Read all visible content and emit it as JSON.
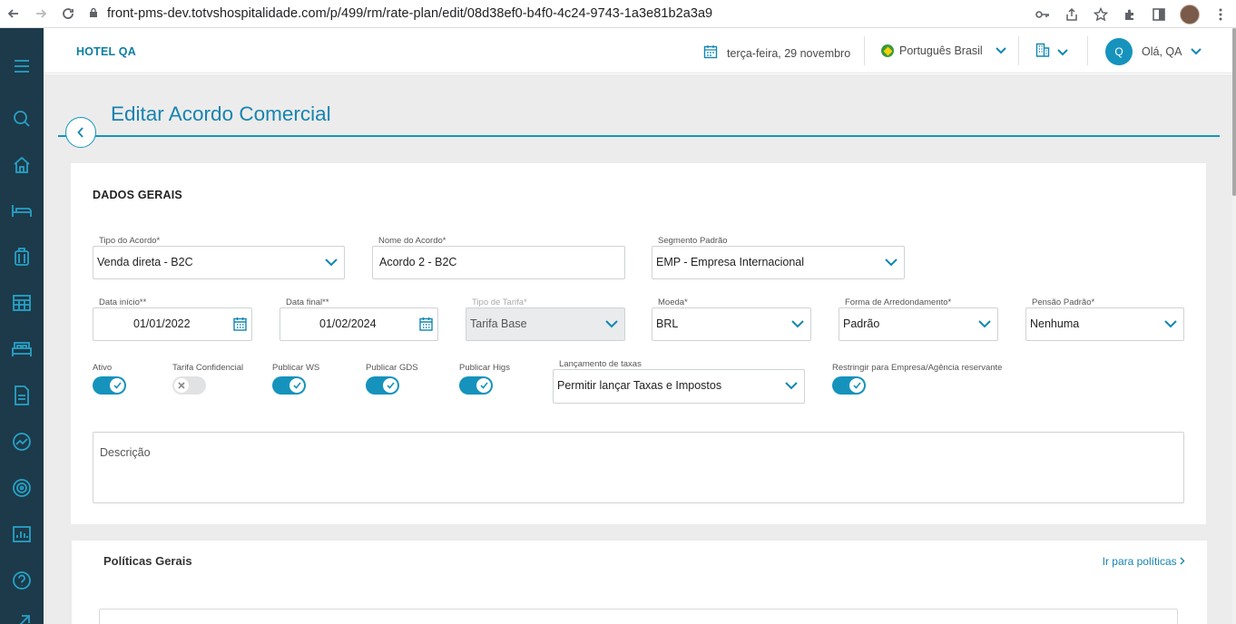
{
  "browser": {
    "url": "front-pms-dev.totvshospitalidade.com/p/499/rm/rate-plan/edit/08d38ef0-b4f0-4c24-9743-1a3e81b2a3a9"
  },
  "header": {
    "hotel_name": "HOTEL QA",
    "date": "terça-feira, 29 novembro",
    "language": "Português Brasil",
    "user_initial": "Q",
    "greeting": "Olá, QA"
  },
  "page": {
    "title": "Editar Acordo Comercial"
  },
  "general": {
    "section_title": "DADOS GERAIS",
    "tipo_acordo": {
      "label": "Tipo do Acordo*",
      "value": "Venda direta - B2C"
    },
    "nome_acordo": {
      "label": "Nome do Acordo*",
      "value": "Acordo 2 - B2C"
    },
    "segmento": {
      "label": "Segmento Padrão",
      "value": "EMP - Empresa Internacional"
    },
    "data_inicio": {
      "label": "Data início**",
      "value": "01/01/2022"
    },
    "data_final": {
      "label": "Data final**",
      "value": "01/02/2024"
    },
    "tipo_tarifa": {
      "label": "Tipo de Tarifa*",
      "value": "Tarifa Base"
    },
    "moeda": {
      "label": "Moeda*",
      "value": "BRL"
    },
    "arredondamento": {
      "label": "Forma de Arredondamento*",
      "value": "Padrão"
    },
    "pensao": {
      "label": "Pensão Padrão*",
      "value": "Nenhuma"
    },
    "toggles": {
      "ativo": {
        "label": "Ativo",
        "on": true
      },
      "confidencial": {
        "label": "Tarifa Confidencial",
        "on": false
      },
      "ws": {
        "label": "Publicar WS",
        "on": true
      },
      "gds": {
        "label": "Publicar GDS",
        "on": true
      },
      "higs": {
        "label": "Publicar Higs",
        "on": true
      },
      "restringir": {
        "label": "Restringir para Empresa/Agência reservante",
        "on": true
      }
    },
    "lancamento": {
      "label": "Lançamento de taxas",
      "value": "Permitir lançar Taxas e Impostos"
    },
    "descricao_placeholder": "Descrição"
  },
  "policies": {
    "title": "Políticas Gerais",
    "link": "Ir para políticas"
  },
  "colors": {
    "accent": "#1693bd",
    "sidebar": "#1c3a4a",
    "background": "#ececec"
  }
}
